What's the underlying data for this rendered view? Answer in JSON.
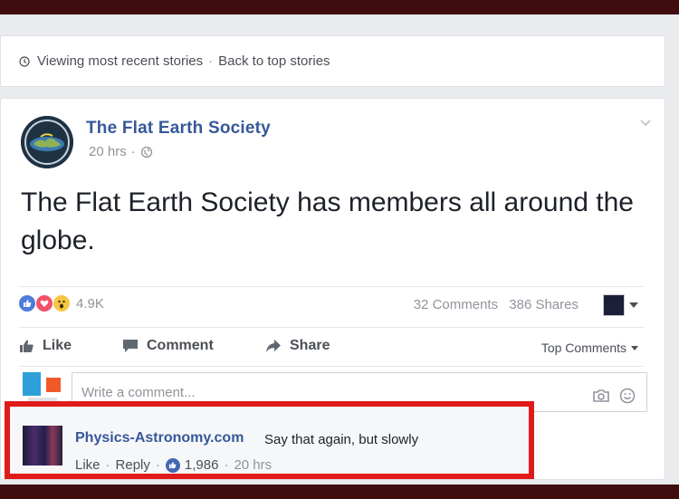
{
  "stories_bar": {
    "viewing": "Viewing most recent stories",
    "separator": "·",
    "back_link": "Back to top stories"
  },
  "post": {
    "author": "The Flat Earth Society",
    "time": "20 hrs",
    "separator": "·",
    "text": "The Flat Earth Society has members all around the globe.",
    "reactions_count": "4.9K",
    "comments_count": "32 Comments",
    "shares_count": "386 Shares",
    "actions": {
      "like": "Like",
      "comment": "Comment",
      "share": "Share"
    },
    "sort_label": "Top Comments",
    "comment_placeholder": "Write a comment..."
  },
  "comment": {
    "author": "Physics-Astronomy.com",
    "text": "Say that again, but slowly",
    "like": "Like",
    "reply": "Reply",
    "likes": "1,986",
    "time": "20 hrs",
    "separator": "·"
  },
  "colors": {
    "link_blue": "#365899",
    "highlight_red": "#e11b1b",
    "frame": "#3f0d0d"
  },
  "icons": {
    "stories": "clock-icon",
    "privacy": "globe-icon",
    "reactions": [
      "like-reaction-icon",
      "love-reaction-icon",
      "wow-reaction-icon"
    ],
    "actions": [
      "thumbs-up-icon",
      "speech-bubble-icon",
      "share-arrow-icon"
    ],
    "input": [
      "camera-icon",
      "smiley-icon"
    ]
  }
}
